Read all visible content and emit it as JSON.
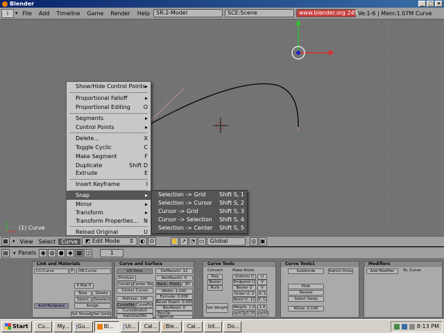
{
  "window": {
    "title": "Blender"
  },
  "menubar": {
    "menus": [
      "File",
      "Add",
      "Timeline",
      "Game",
      "Render",
      "Help"
    ],
    "screen": "SR:2-Model",
    "scene": "SCE:Scene",
    "url": "www.blender.org 245",
    "stats": "Ve:1-6 | Mem:1.07M Curve"
  },
  "viewport": {
    "object_label": "(1) Curve"
  },
  "menu": {
    "items": [
      {
        "label": "Show/Hide Control Points",
        "shortcut": "",
        "arrow": "▸"
      },
      {
        "label": "Proportional Falloff",
        "shortcut": "",
        "arrow": "▸"
      },
      {
        "label": "Proportional Editing",
        "shortcut": "O",
        "arrow": ""
      },
      {
        "label": "Segments",
        "shortcut": "",
        "arrow": "▸"
      },
      {
        "label": "Control Points",
        "shortcut": "",
        "arrow": "▸"
      },
      {
        "label": "Delete...",
        "shortcut": "X",
        "arrow": ""
      },
      {
        "label": "Toggle Cyclic",
        "shortcut": "C",
        "arrow": ""
      },
      {
        "label": "Make Segment",
        "shortcut": "F",
        "arrow": ""
      },
      {
        "label": "Duplicate",
        "shortcut": "Shift D",
        "arrow": ""
      },
      {
        "label": "Extrude",
        "shortcut": "E",
        "arrow": ""
      },
      {
        "label": "Insert Keyframe",
        "shortcut": "I",
        "arrow": ""
      },
      {
        "label": "Snap",
        "shortcut": "",
        "arrow": "▸"
      },
      {
        "label": "Mirror",
        "shortcut": "",
        "arrow": "▸"
      },
      {
        "label": "Transform",
        "shortcut": "",
        "arrow": "▸"
      },
      {
        "label": "Transform Properties...",
        "shortcut": "N",
        "arrow": ""
      },
      {
        "label": "Reload Original",
        "shortcut": "U",
        "arrow": ""
      }
    ]
  },
  "submenu": {
    "items": [
      {
        "label": "Selection -> Grid",
        "shortcut": "Shift S, 1"
      },
      {
        "label": "Selection -> Cursor",
        "shortcut": "Shift S, 2"
      },
      {
        "label": "Cursor -> Grid",
        "shortcut": "Shift S, 3"
      },
      {
        "label": "Cursor -> Selection",
        "shortcut": "Shift S, 4"
      },
      {
        "label": "Selection -> Center",
        "shortcut": "Shift S, 5"
      }
    ]
  },
  "header": {
    "view": "View",
    "select": "Select",
    "curve": "Curve",
    "mode": "Edit Mode",
    "orientation": "Global"
  },
  "panelsbar": {
    "label": "Panels",
    "frame": "1"
  },
  "panels": {
    "link": {
      "title": "Link and Materials",
      "me": "CU:Curve",
      "f": "F",
      "ob": "OB:Curve",
      "mat": "0 Mat 0",
      "new": "New",
      "delete": "Delete",
      "select": "Select",
      "deselect": "Deselect",
      "assign": "Assign",
      "autotex": "AutoTexSpace",
      "smooth": "Set Smooth",
      "solid": "Set Solid"
    },
    "surface": {
      "title": "Curve and Surface",
      "uv_orco": "UV Orco",
      "print_len": "PrintLen",
      "center": "Center",
      "center_new": "Center New",
      "center_cursor": "Center Cursor",
      "path_len": "PathLen: 100",
      "curve_path": "CurvePath",
      "curve_follow": "CurveFollo",
      "curve_stretch": "CurveStretch",
      "path_dist_offs": "PathDistOffs",
      "def_resol_u": "DefResolU: 12",
      "ren_resol_u": "RenResolU: 0",
      "back": "Back",
      "front": "Front",
      "three_d": "3D",
      "width": "Width: 1.000",
      "extrude": "Extrude: 0.000",
      "bevel_depth": "Bevel Depth: 0.000",
      "bev_resol": "BevResol: 0",
      "bev_ob": "BevOb:",
      "taper_ob": "TaperOb:"
    },
    "tools": {
      "title": "Curve Tools",
      "convert": "Convert",
      "poly": "Poly",
      "bezier": "Bezier",
      "nurb": "Nurb",
      "make_knots": "Make Knots",
      "uniform_u": "Uniform U",
      "endpoint_u": "Endpoint U",
      "bezier_u": "Bezier U",
      "u": "U",
      "v": "V",
      "order_u": "Order U: 2",
      "v2": "V: 2",
      "resol_u": "Resol U: 12",
      "v12": "V: 12",
      "set_weight": "Set Weight",
      "weight": "Weight: 1.00",
      "w1": "1.0",
      "sqrt2": "sqrt(2)/4",
      "w025": "0.25",
      "sqrt05": "sqrt(0.5)"
    },
    "tools1": {
      "title": "Curve Tools1",
      "subdivide": "Subdivide",
      "switch": "Switch Direction",
      "hide": "Hide",
      "reveal": "Reveal",
      "select_swap": "Select Swap",
      "nsize": "NSize: 0.100"
    },
    "modifiers": {
      "title": "Modifiers",
      "add": "Add Modifier",
      "to": "To: Curve"
    }
  },
  "taskbar": {
    "start": "Start",
    "tasks": [
      "Cu...",
      "My...",
      "Gu...",
      "Bl...",
      "Ur...",
      "Cal...",
      "Ble...",
      "Cal...",
      "Int...",
      "Do..."
    ],
    "clock": "8:13 PM"
  }
}
